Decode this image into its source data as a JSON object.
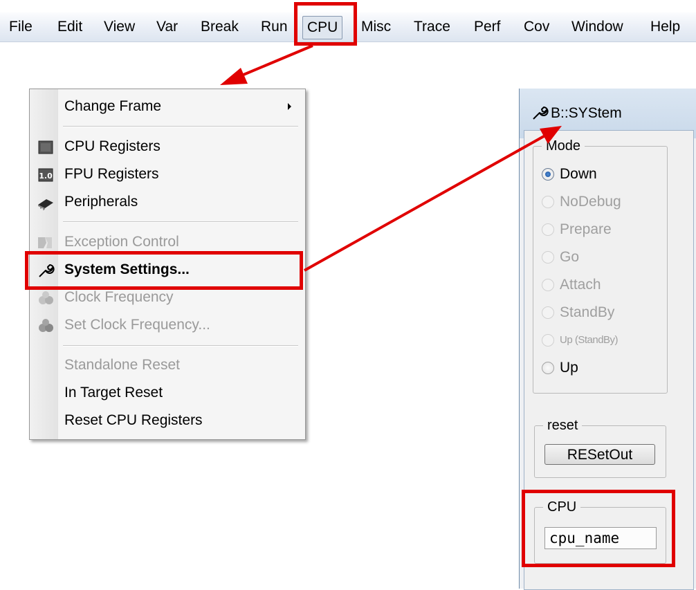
{
  "menubar": {
    "items": [
      "File",
      "Edit",
      "View",
      "Var",
      "Break",
      "Run",
      "CPU",
      "Misc",
      "Trace",
      "Perf",
      "Cov",
      "Window",
      "Help"
    ]
  },
  "cpu_menu": {
    "change_frame": "Change Frame",
    "cpu_registers": "CPU Registers",
    "fpu_registers": "FPU Registers",
    "fpu_icon_text": "1.0",
    "peripherals": "Peripherals",
    "exception_control": "Exception Control",
    "system_settings": "System Settings...",
    "clock_frequency": "Clock Frequency",
    "set_clock_frequency": "Set Clock Frequency...",
    "standalone_reset": "Standalone Reset",
    "in_target_reset": "In Target Reset",
    "reset_cpu_registers": "Reset CPU Registers"
  },
  "system_dialog": {
    "title": "B::SYStem",
    "mode_label": "Mode",
    "modes": [
      "Down",
      "NoDebug",
      "Prepare",
      "Go",
      "Attach",
      "StandBy",
      "Up (StandBy)",
      "Up"
    ],
    "selected_mode": "Down",
    "reset_label": "reset",
    "reset_button": "RESetOut",
    "cpu_label": "CPU",
    "cpu_value": "cpu_name"
  },
  "colors": {
    "highlight": "#e00000",
    "disabled_text": "#9a9a9a"
  }
}
